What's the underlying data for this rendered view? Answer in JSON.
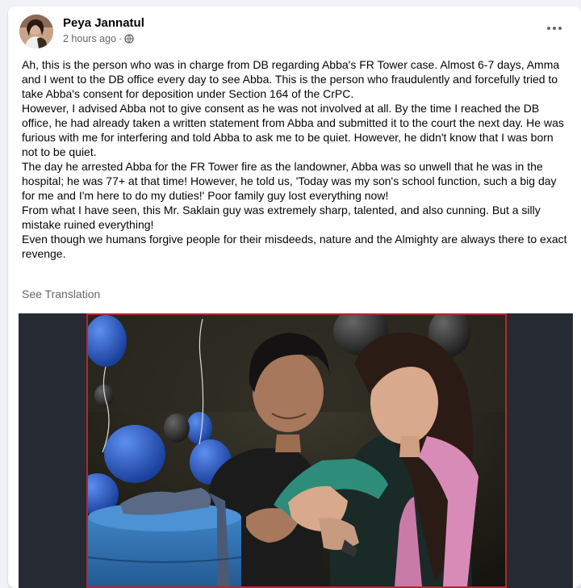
{
  "post": {
    "author": "Peya Jannatul",
    "time": "2 hours ago",
    "time_separator": "·",
    "audience_icon": "globe-icon",
    "more_icon": "more-options-icon",
    "paragraphs": [
      "Ah, this is the person who was in charge from DB regarding Abba's FR Tower case. Almost 6-7 days, Amma and I went to the DB office every day to see Abba. This is the person who fraudulently and forcefully tried to take Abba's consent for deposition under Section 164 of the CrPC.",
      "However, I advised Abba not to give consent as he was not involved at all. By the time I reached the DB office, he had already taken a written statement from Abba and submitted it to the court the next day. He was furious with me for interfering and told Abba to ask me to be quiet. However, he didn't know that I was born not to be quiet.",
      "The day he arrested Abba for the FR Tower fire as the landowner, Abba was so unwell that he was in the hospital; he was 77+ at that time! However, he told us, 'Today was my son's school function, such a big day for me and I'm here to do my duties!' Poor family guy lost everything now!",
      "From what I have seen, this Mr. Saklain guy was extremely sharp, talented, and also cunning. But a silly mistake ruined everything!",
      "Even though we humans forgive people for their misdeeds, nature and the Almighty are always there to exact revenge."
    ],
    "see_translation": "See Translation"
  },
  "colors": {
    "page_bg": "#f0f2f5",
    "card_bg": "#ffffff",
    "text_primary": "#050505",
    "text_secondary": "#65676b",
    "photo_border": "#b3272e",
    "cake_blue": "#2f6fae"
  }
}
